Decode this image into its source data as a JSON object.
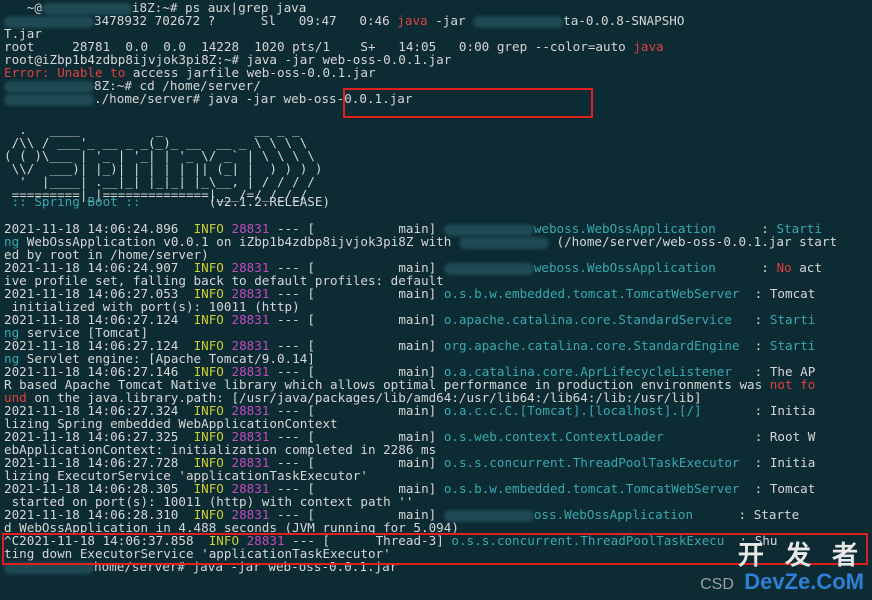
{
  "terminal": {
    "lines": [
      {
        "id": "l0",
        "segs": [
          [
            "gray",
            "   ~@"
          ],
          [
            "blur",
            ""
          ],
          [
            "gray",
            "i8Z:~# ps aux|grep java"
          ]
        ]
      },
      {
        "id": "l1",
        "segs": [
          [
            "blur",
            ""
          ],
          [
            "gray",
            "3478932 702672 ?      Sl   09:47   0:46 "
          ],
          [
            "red",
            "java"
          ],
          [
            "gray",
            " -jar "
          ],
          [
            "blur",
            ""
          ],
          [
            "gray",
            "ta-0.0.8-SNAPSHO"
          ]
        ]
      },
      {
        "id": "l2",
        "segs": [
          [
            "gray",
            "T.jar"
          ]
        ]
      },
      {
        "id": "l3",
        "segs": [
          [
            "gray",
            "root     28781  0.0  0.0  14228  1020 pts/1    S+   14:05   0:00 grep --color=auto "
          ],
          [
            "red",
            "java"
          ]
        ]
      },
      {
        "id": "l4",
        "segs": [
          [
            "gray",
            "root@iZbp1b4zdbp8ijvjok3pi8Z:~# java -jar web-oss-0.0.1.jar"
          ]
        ]
      },
      {
        "id": "l5",
        "segs": [
          [
            "red",
            "Error: Unable to "
          ],
          [
            "gray",
            "access jarfile web-oss-0.0.1.jar"
          ]
        ]
      },
      {
        "id": "l6",
        "segs": [
          [
            "blur",
            ""
          ],
          [
            "gray",
            "8Z:~# cd /home/server/"
          ]
        ]
      },
      {
        "id": "l7",
        "segs": [
          [
            "blur",
            ""
          ],
          [
            "gray",
            "./home/server# java -jar web-oss-0.0.1.jar"
          ]
        ]
      }
    ],
    "banner": "  .   ____          _            __ _ _\n /\\\\ / ___'_ __ _ _(_)_ __  __ _ \\ \\ \\ \\\n( ( )\\___ | '_ | '_| | '_ \\/ _` | \\ \\ \\ \\\n \\\\/  ___)| |_)| | | | | || (_| |  ) ) ) )\n  '  |____| .__|_| |_|_| |_\\__, | / / / /\n =========|_|==============|___/=/_/_/_/",
    "spring_label": " :: Spring Boot :: ",
    "spring_version": "        (v2.1.2.RELEASE)",
    "logs": [
      {
        "id": "g1",
        "segs": [
          [
            "gray",
            "2021-11-18 14:06:24.896  "
          ],
          [
            "yellow",
            "INFO"
          ],
          [
            "gray",
            " "
          ],
          [
            "magenta",
            "28831"
          ],
          [
            "gray",
            " --- [           main] "
          ],
          [
            "blur",
            ""
          ],
          [
            "cyan",
            "weboss.WebOssApplication"
          ],
          [
            "gray",
            "      : "
          ],
          [
            "cyan",
            "Starti"
          ]
        ]
      },
      {
        "id": "g1b",
        "segs": [
          [
            "cyan",
            "ng"
          ],
          [
            "gray",
            " WebOssApplication v0.0.1 on iZbp1b4zdbp8ijvjok3pi8Z with "
          ],
          [
            "blur",
            ""
          ],
          [
            "gray",
            " (/home/server/web-oss-0.0.1.jar start"
          ]
        ]
      },
      {
        "id": "g1c",
        "segs": [
          [
            "gray",
            "ed by root in /home/server)"
          ]
        ]
      },
      {
        "id": "g2",
        "segs": [
          [
            "gray",
            "2021-11-18 14:06:24.907  "
          ],
          [
            "yellow",
            "INFO"
          ],
          [
            "gray",
            " "
          ],
          [
            "magenta",
            "28831"
          ],
          [
            "gray",
            " --- [           main] "
          ],
          [
            "blur",
            ""
          ],
          [
            "cyan",
            "weboss.WebOssApplication"
          ],
          [
            "gray",
            "      : "
          ],
          [
            "red",
            "No"
          ],
          [
            "gray",
            " act"
          ]
        ]
      },
      {
        "id": "g2b",
        "segs": [
          [
            "gray",
            "ive profile set, falling back to default profiles: default"
          ]
        ]
      },
      {
        "id": "g3",
        "segs": [
          [
            "gray",
            "2021-11-18 14:06:27.053  "
          ],
          [
            "yellow",
            "INFO"
          ],
          [
            "gray",
            " "
          ],
          [
            "magenta",
            "28831"
          ],
          [
            "gray",
            " --- [           main] "
          ],
          [
            "cyan",
            "o.s.b.w.embedded.tomcat.TomcatWebServer"
          ],
          [
            "gray",
            "  : Tomcat"
          ]
        ]
      },
      {
        "id": "g3b",
        "segs": [
          [
            "gray",
            " initialized with port(s): 10011 (http)"
          ]
        ]
      },
      {
        "id": "g4",
        "segs": [
          [
            "gray",
            "2021-11-18 14:06:27.124  "
          ],
          [
            "yellow",
            "INFO"
          ],
          [
            "gray",
            " "
          ],
          [
            "magenta",
            "28831"
          ],
          [
            "gray",
            " --- [           main] "
          ],
          [
            "cyan",
            "o.apache.catalina.core.StandardService"
          ],
          [
            "gray",
            "   : "
          ],
          [
            "cyan",
            "Starti"
          ]
        ]
      },
      {
        "id": "g4b",
        "segs": [
          [
            "cyan",
            "ng"
          ],
          [
            "gray",
            " service [Tomcat]"
          ]
        ]
      },
      {
        "id": "g5",
        "segs": [
          [
            "gray",
            "2021-11-18 14:06:27.124  "
          ],
          [
            "yellow",
            "INFO"
          ],
          [
            "gray",
            " "
          ],
          [
            "magenta",
            "28831"
          ],
          [
            "gray",
            " --- [           main] "
          ],
          [
            "cyan",
            "org.apache.catalina.core.StandardEngine"
          ],
          [
            "gray",
            "  : "
          ],
          [
            "cyan",
            "Starti"
          ]
        ]
      },
      {
        "id": "g5b",
        "segs": [
          [
            "cyan",
            "ng"
          ],
          [
            "gray",
            " Servlet engine: [Apache Tomcat/9.0.14]"
          ]
        ]
      },
      {
        "id": "g6",
        "segs": [
          [
            "gray",
            "2021-11-18 14:06:27.146  "
          ],
          [
            "yellow",
            "INFO"
          ],
          [
            "gray",
            " "
          ],
          [
            "magenta",
            "28831"
          ],
          [
            "gray",
            " --- [           main] "
          ],
          [
            "cyan",
            "o.a.catalina.core.AprLifecycleListener"
          ],
          [
            "gray",
            "   : The AP"
          ]
        ]
      },
      {
        "id": "g6b",
        "segs": [
          [
            "gray",
            "R based Apache Tomcat Native library which allows optimal performance in production environments was "
          ],
          [
            "red",
            "not fo"
          ]
        ]
      },
      {
        "id": "g6c",
        "segs": [
          [
            "red",
            "und"
          ],
          [
            "gray",
            " on the java.library.path: [/usr/java/packages/lib/amd64:/usr/lib64:/lib64:/lib:/usr/lib]"
          ]
        ]
      },
      {
        "id": "g7",
        "segs": [
          [
            "gray",
            "2021-11-18 14:06:27.324  "
          ],
          [
            "yellow",
            "INFO"
          ],
          [
            "gray",
            " "
          ],
          [
            "magenta",
            "28831"
          ],
          [
            "gray",
            " --- [           main] "
          ],
          [
            "cyan",
            "o.a.c.c.C.[Tomcat].[localhost].[/]"
          ],
          [
            "gray",
            "       : Initia"
          ]
        ]
      },
      {
        "id": "g7b",
        "segs": [
          [
            "gray",
            "lizing Spring embedded WebApplicationContext"
          ]
        ]
      },
      {
        "id": "g8",
        "segs": [
          [
            "gray",
            "2021-11-18 14:06:27.325  "
          ],
          [
            "yellow",
            "INFO"
          ],
          [
            "gray",
            " "
          ],
          [
            "magenta",
            "28831"
          ],
          [
            "gray",
            " --- [           main] "
          ],
          [
            "cyan",
            "o.s.web.context.ContextLoader"
          ],
          [
            "gray",
            "            : Root W"
          ]
        ]
      },
      {
        "id": "g8b",
        "segs": [
          [
            "gray",
            "ebApplicationContext: initialization completed in 2286 ms"
          ]
        ]
      },
      {
        "id": "g9",
        "segs": [
          [
            "gray",
            "2021-11-18 14:06:27.728  "
          ],
          [
            "yellow",
            "INFO"
          ],
          [
            "gray",
            " "
          ],
          [
            "magenta",
            "28831"
          ],
          [
            "gray",
            " --- [           main] "
          ],
          [
            "cyan",
            "o.s.s.concurrent.ThreadPoolTaskExecutor"
          ],
          [
            "gray",
            "  : Initia"
          ]
        ]
      },
      {
        "id": "g9b",
        "segs": [
          [
            "gray",
            "lizing ExecutorService 'applicationTaskExecutor'"
          ]
        ]
      },
      {
        "id": "g10",
        "segs": [
          [
            "gray",
            "2021-11-18 14:06:28.305  "
          ],
          [
            "yellow",
            "INFO"
          ],
          [
            "gray",
            " "
          ],
          [
            "magenta",
            "28831"
          ],
          [
            "gray",
            " --- [           main] "
          ],
          [
            "cyan",
            "o.s.b.w.embedded.tomcat.TomcatWebServer"
          ],
          [
            "gray",
            "  : Tomcat"
          ]
        ]
      },
      {
        "id": "g10b",
        "segs": [
          [
            "gray",
            " started on port(s): 10011 (http) with context path ''"
          ]
        ]
      },
      {
        "id": "g11",
        "segs": [
          [
            "gray",
            "2021-11-18 14:06:28.310  "
          ],
          [
            "yellow",
            "INFO"
          ],
          [
            "gray",
            " "
          ],
          [
            "magenta",
            "28831"
          ],
          [
            "gray",
            " --- [           main] "
          ],
          [
            "blur",
            ""
          ],
          [
            "cyan",
            "oss.WebOssApplication"
          ],
          [
            "gray",
            "      : Starte"
          ]
        ]
      },
      {
        "id": "g11b",
        "segs": [
          [
            "gray",
            "d WebOssApplication in 4.488 seconds (JVM running for 5.094)"
          ]
        ]
      },
      {
        "id": "g12",
        "segs": [
          [
            "gray",
            "^C2021-11-18 14:06:37.858  "
          ],
          [
            "yellow",
            "INFO"
          ],
          [
            "gray",
            " "
          ],
          [
            "magenta",
            "28831"
          ],
          [
            "gray",
            " --- [      Thread-3] "
          ],
          [
            "cyan",
            "o.s.s.concurrent.ThreadPoolTaskExecu"
          ],
          [
            "gray",
            "  : Shu"
          ]
        ]
      },
      {
        "id": "g12b",
        "segs": [
          [
            "gray",
            "ting down ExecutorService 'applicationTaskExecutor'"
          ]
        ]
      },
      {
        "id": "g13",
        "segs": [
          [
            "blur",
            ""
          ],
          [
            "gray",
            "home/server# java -jar web-oss-0.0.1.jar"
          ]
        ]
      }
    ]
  },
  "watermark": {
    "prefix": "CSD",
    "cn": "开 发 者",
    "url": "DevZe.CoM"
  },
  "colors": {
    "background": "#0c2b33",
    "highlight_box": "#e02020"
  }
}
